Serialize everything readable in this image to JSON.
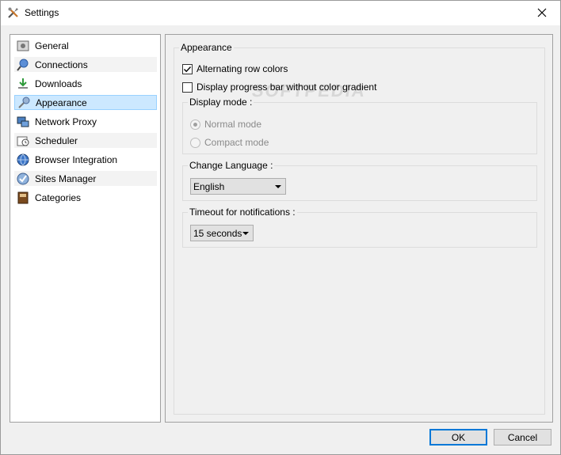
{
  "window": {
    "title": "Settings"
  },
  "sidebar": {
    "items": [
      {
        "label": "General",
        "icon": "general-icon"
      },
      {
        "label": "Connections",
        "icon": "connections-icon"
      },
      {
        "label": "Downloads",
        "icon": "downloads-icon"
      },
      {
        "label": "Appearance",
        "icon": "appearance-icon",
        "selected": true
      },
      {
        "label": "Network Proxy",
        "icon": "network-proxy-icon"
      },
      {
        "label": "Scheduler",
        "icon": "scheduler-icon"
      },
      {
        "label": "Browser Integration",
        "icon": "browser-integration-icon"
      },
      {
        "label": "Sites Manager",
        "icon": "sites-manager-icon"
      },
      {
        "label": "Categories",
        "icon": "categories-icon"
      }
    ]
  },
  "appearance": {
    "group_title": "Appearance",
    "alternating_row_colors": {
      "label": "Alternating row colors",
      "checked": true
    },
    "progress_no_gradient": {
      "label": "Display progress bar without color gradient",
      "checked": false
    },
    "display_mode": {
      "title": "Display mode :",
      "normal": {
        "label": "Normal mode",
        "selected": true
      },
      "compact": {
        "label": "Compact mode",
        "selected": false
      }
    },
    "language": {
      "title": "Change Language :",
      "value": "English"
    },
    "timeout": {
      "title": "Timeout for notifications :",
      "value": "15 seconds"
    }
  },
  "footer": {
    "ok_label": "OK",
    "cancel_label": "Cancel"
  },
  "watermark": "SOFTPEDIA",
  "colors": {
    "selection_bg": "#cce8ff",
    "selection_border": "#99d1ff",
    "default_button_border": "#0078d7"
  }
}
